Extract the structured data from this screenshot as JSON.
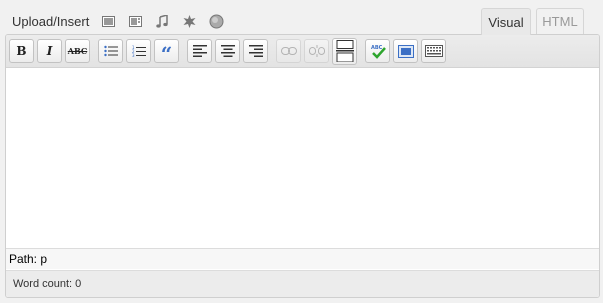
{
  "media": {
    "label": "Upload/Insert",
    "icons": [
      "add-image-icon",
      "add-video-icon",
      "add-audio-icon",
      "add-media-icon",
      "add-other-icon"
    ]
  },
  "tabs": {
    "visual": "Visual",
    "html": "HTML"
  },
  "toolbar": {
    "bold": "B",
    "italic": "I",
    "strikethrough": "ABC",
    "blockquote": "“"
  },
  "footer": {
    "path": "Path: p",
    "word_count": "Word count: 0"
  },
  "colors": {
    "accent_blue": "#3b6fc5",
    "spell_green": "#2ea52e"
  }
}
